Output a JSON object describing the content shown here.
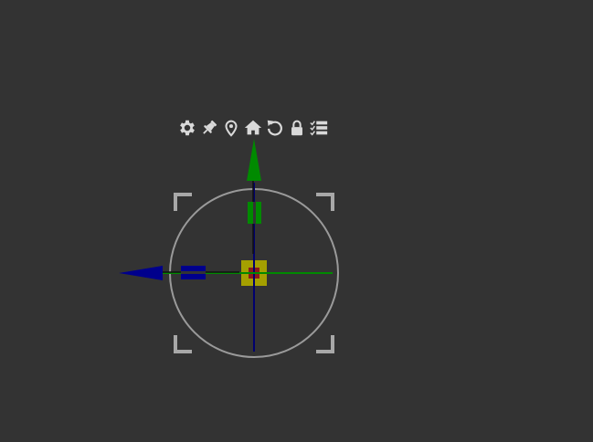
{
  "toolbar": {
    "tools": [
      {
        "name": "settings",
        "icon": "gear-icon"
      },
      {
        "name": "pin",
        "icon": "pushpin-icon"
      },
      {
        "name": "location",
        "icon": "map-marker-icon"
      },
      {
        "name": "home",
        "icon": "home-icon"
      },
      {
        "name": "reset",
        "icon": "rotate-icon"
      },
      {
        "name": "lock",
        "icon": "lock-icon"
      },
      {
        "name": "checklist",
        "icon": "checklist-icon"
      }
    ],
    "icon_color": "#d9d9d9"
  },
  "gizmo": {
    "colors": {
      "y_axis": "#008a00",
      "x_axis": "#00008c",
      "center": "#a5a000",
      "center_inner": "#8c1a1a",
      "ring": "#9a9a9a",
      "corners": "#a8a8a8",
      "background": "#333333"
    }
  }
}
